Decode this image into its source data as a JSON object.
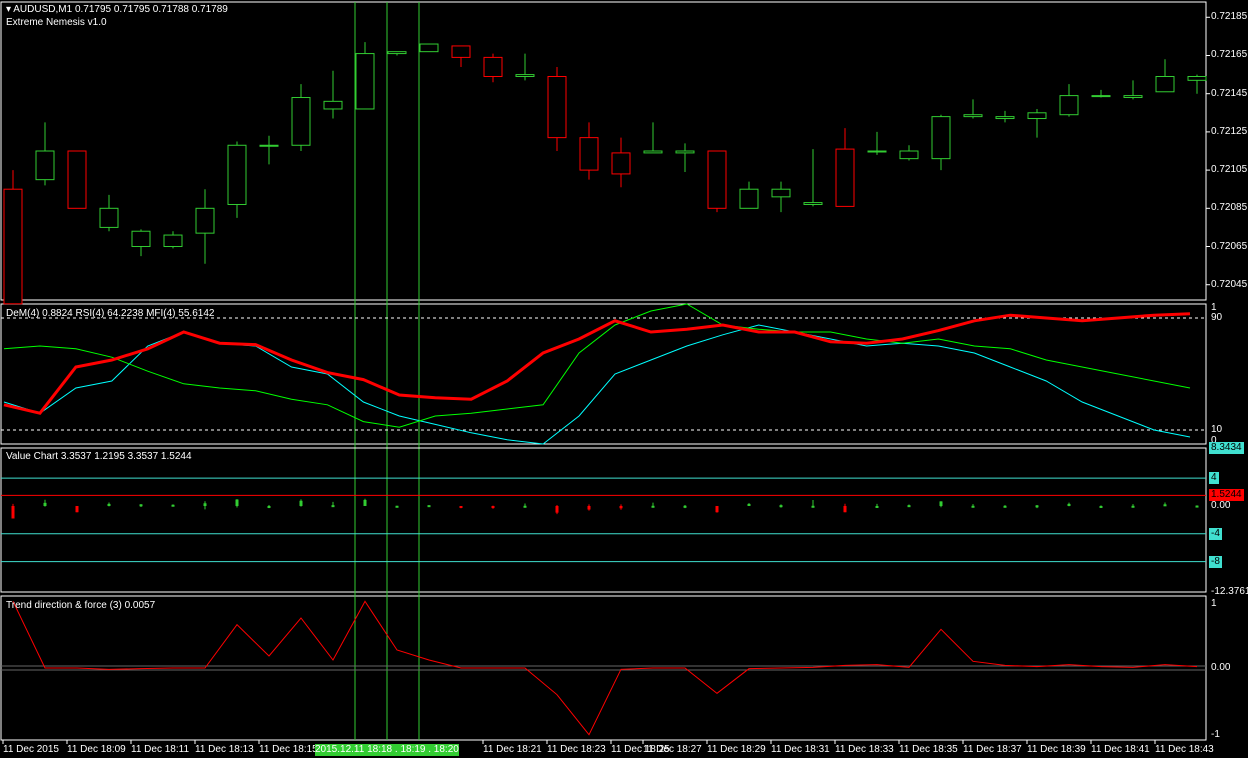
{
  "main": {
    "title": "AUDUSD,M1  0.71795 0.71795 0.71788 0.71789",
    "indicator": "Extreme Nemesis v1.0",
    "price_ticks": [
      "0.72185",
      "0.72165",
      "0.72145",
      "0.72125",
      "0.72105",
      "0.72085",
      "0.72065",
      "0.72045"
    ],
    "candles": [
      {
        "o": 0.72095,
        "h": 0.72105,
        "l": 0.72035,
        "c": 0.72035
      },
      {
        "o": 0.721,
        "h": 0.7213,
        "l": 0.72097,
        "c": 0.72115
      },
      {
        "o": 0.72115,
        "h": 0.72115,
        "l": 0.72085,
        "c": 0.72085
      },
      {
        "o": 0.72075,
        "h": 0.72092,
        "l": 0.72073,
        "c": 0.72085
      },
      {
        "o": 0.72065,
        "h": 0.72074,
        "l": 0.7206,
        "c": 0.72073
      },
      {
        "o": 0.72065,
        "h": 0.72073,
        "l": 0.72064,
        "c": 0.72071
      },
      {
        "o": 0.72072,
        "h": 0.72095,
        "l": 0.72056,
        "c": 0.72085
      },
      {
        "o": 0.72087,
        "h": 0.7212,
        "l": 0.7208,
        "c": 0.72118
      },
      {
        "o": 0.72118,
        "h": 0.72123,
        "l": 0.72108,
        "c": 0.72118
      },
      {
        "o": 0.72118,
        "h": 0.7215,
        "l": 0.72115,
        "c": 0.72143
      },
      {
        "o": 0.72137,
        "h": 0.72157,
        "l": 0.72132,
        "c": 0.72141
      },
      {
        "o": 0.72137,
        "h": 0.72172,
        "l": 0.72137,
        "c": 0.72166
      },
      {
        "o": 0.72166,
        "h": 0.72167,
        "l": 0.72165,
        "c": 0.72167
      },
      {
        "o": 0.72167,
        "h": 0.7217,
        "l": 0.72167,
        "c": 0.72171
      },
      {
        "o": 0.7217,
        "h": 0.7217,
        "l": 0.72159,
        "c": 0.72164
      },
      {
        "o": 0.72164,
        "h": 0.72166,
        "l": 0.72151,
        "c": 0.72154
      },
      {
        "o": 0.72154,
        "h": 0.72166,
        "l": 0.72152,
        "c": 0.72155
      },
      {
        "o": 0.72154,
        "h": 0.72159,
        "l": 0.72115,
        "c": 0.72122
      },
      {
        "o": 0.72122,
        "h": 0.7213,
        "l": 0.721,
        "c": 0.72105
      },
      {
        "o": 0.72114,
        "h": 0.72122,
        "l": 0.72096,
        "c": 0.72103
      },
      {
        "o": 0.72114,
        "h": 0.7213,
        "l": 0.72114,
        "c": 0.72115
      },
      {
        "o": 0.72114,
        "h": 0.72119,
        "l": 0.72104,
        "c": 0.72115
      },
      {
        "o": 0.72115,
        "h": 0.72115,
        "l": 0.72083,
        "c": 0.72085
      },
      {
        "o": 0.72085,
        "h": 0.72099,
        "l": 0.72085,
        "c": 0.72095
      },
      {
        "o": 0.72091,
        "h": 0.72099,
        "l": 0.72083,
        "c": 0.72095
      },
      {
        "o": 0.72087,
        "h": 0.72116,
        "l": 0.72086,
        "c": 0.72088
      },
      {
        "o": 0.72116,
        "h": 0.72127,
        "l": 0.72086,
        "c": 0.72086
      },
      {
        "o": 0.72115,
        "h": 0.72125,
        "l": 0.72113,
        "c": 0.72115
      },
      {
        "o": 0.72111,
        "h": 0.72118,
        "l": 0.7211,
        "c": 0.72115
      },
      {
        "o": 0.72111,
        "h": 0.72134,
        "l": 0.72105,
        "c": 0.72133
      },
      {
        "o": 0.72133,
        "h": 0.72142,
        "l": 0.72132,
        "c": 0.72134
      },
      {
        "o": 0.72132,
        "h": 0.72136,
        "l": 0.7213,
        "c": 0.72133
      },
      {
        "o": 0.72132,
        "h": 0.72137,
        "l": 0.72122,
        "c": 0.72135
      },
      {
        "o": 0.72134,
        "h": 0.7215,
        "l": 0.72133,
        "c": 0.72144
      },
      {
        "o": 0.72144,
        "h": 0.72147,
        "l": 0.72143,
        "c": 0.72144
      },
      {
        "o": 0.72143,
        "h": 0.72152,
        "l": 0.72142,
        "c": 0.72144
      },
      {
        "o": 0.72146,
        "h": 0.72163,
        "l": 0.72146,
        "c": 0.72154
      },
      {
        "o": 0.72152,
        "h": 0.72155,
        "l": 0.72145,
        "c": 0.72154
      }
    ]
  },
  "osc": {
    "title": "DeM(4) 0.8824  RSI(4) 64.2238  MFI(4) 55.6142",
    "ticks": [
      "1",
      "90",
      "10",
      "0"
    ],
    "dem": [
      0.28,
      0.22,
      0.55,
      0.6,
      0.68,
      0.8,
      0.72,
      0.71,
      0.6,
      0.51,
      0.46,
      0.35,
      0.33,
      0.32,
      0.45,
      0.65,
      0.75,
      0.88,
      0.8,
      0.82,
      0.85,
      0.8,
      0.8,
      0.73,
      0.72,
      0.75,
      0.81,
      0.88,
      0.92,
      0.9,
      0.88,
      0.9,
      0.92,
      0.93
    ],
    "rsi": [
      0.68,
      0.7,
      0.68,
      0.62,
      0.52,
      0.43,
      0.4,
      0.38,
      0.32,
      0.28,
      0.16,
      0.12,
      0.2,
      0.22,
      0.25,
      0.28,
      0.65,
      0.85,
      0.95,
      1.0,
      0.85,
      0.82,
      0.8,
      0.8,
      0.75,
      0.72,
      0.75,
      0.7,
      0.68,
      0.6,
      0.55,
      0.5,
      0.45,
      0.4
    ],
    "mfi": [
      0.3,
      0.22,
      0.4,
      0.45,
      0.7,
      0.8,
      0.72,
      0.7,
      0.55,
      0.5,
      0.3,
      0.2,
      0.14,
      0.08,
      0.03,
      0.0,
      0.2,
      0.5,
      0.6,
      0.7,
      0.78,
      0.85,
      0.8,
      0.75,
      0.7,
      0.72,
      0.7,
      0.65,
      0.55,
      0.45,
      0.3,
      0.2,
      0.1,
      0.05
    ]
  },
  "value_chart": {
    "title": "Value Chart 3.3537 1.2195 3.3537 1.5244",
    "ticks": [
      "8.3434",
      "4",
      "1.5244",
      "0.00",
      "-4",
      "-8",
      "-12.3761"
    ]
  },
  "trend": {
    "title": "Trend direction & force (3) 0.0057",
    "ticks": [
      "1",
      "0.00",
      "-1"
    ],
    "values": [
      1.0,
      0.0,
      0.0,
      -0.02,
      -0.01,
      0.0,
      0.0,
      0.65,
      0.18,
      0.75,
      0.12,
      1.0,
      0.27,
      0.12,
      0.0,
      0.0,
      0.0,
      -0.4,
      -1.0,
      -0.02,
      0.0,
      0.0,
      -0.38,
      -0.01,
      0.0,
      0.01,
      0.04,
      0.05,
      0.01,
      0.58,
      0.1,
      0.04,
      0.02,
      0.05,
      0.02,
      0.01,
      0.05,
      0.02
    ]
  },
  "time_axis": {
    "labels": [
      "11 Dec 2015",
      "11 Dec 18:09",
      "11 Dec 18:11",
      "11 Dec 18:13",
      "11 Dec 18:15",
      "2015.12.11 18:18 . 18:19 . 18:20",
      "11 Dec 18:21",
      "11 Dec 18:23",
      "11 Dec 18:25",
      "11 Dec 18:27",
      "11 Dec 18:29",
      "11 Dec 18:31",
      "11 Dec 18:33",
      "11 Dec 18:35",
      "11 Dec 18:37",
      "11 Dec 18:39",
      "11 Dec 18:41",
      "11 Dec 18:43"
    ]
  },
  "colors": {
    "bull": "#32cd32",
    "bear": "#ff0000",
    "grid": "#ffffff",
    "osc_rsi": "#00ff00",
    "osc_mfi": "#00ffff",
    "vc_line": "#40e0d0"
  }
}
